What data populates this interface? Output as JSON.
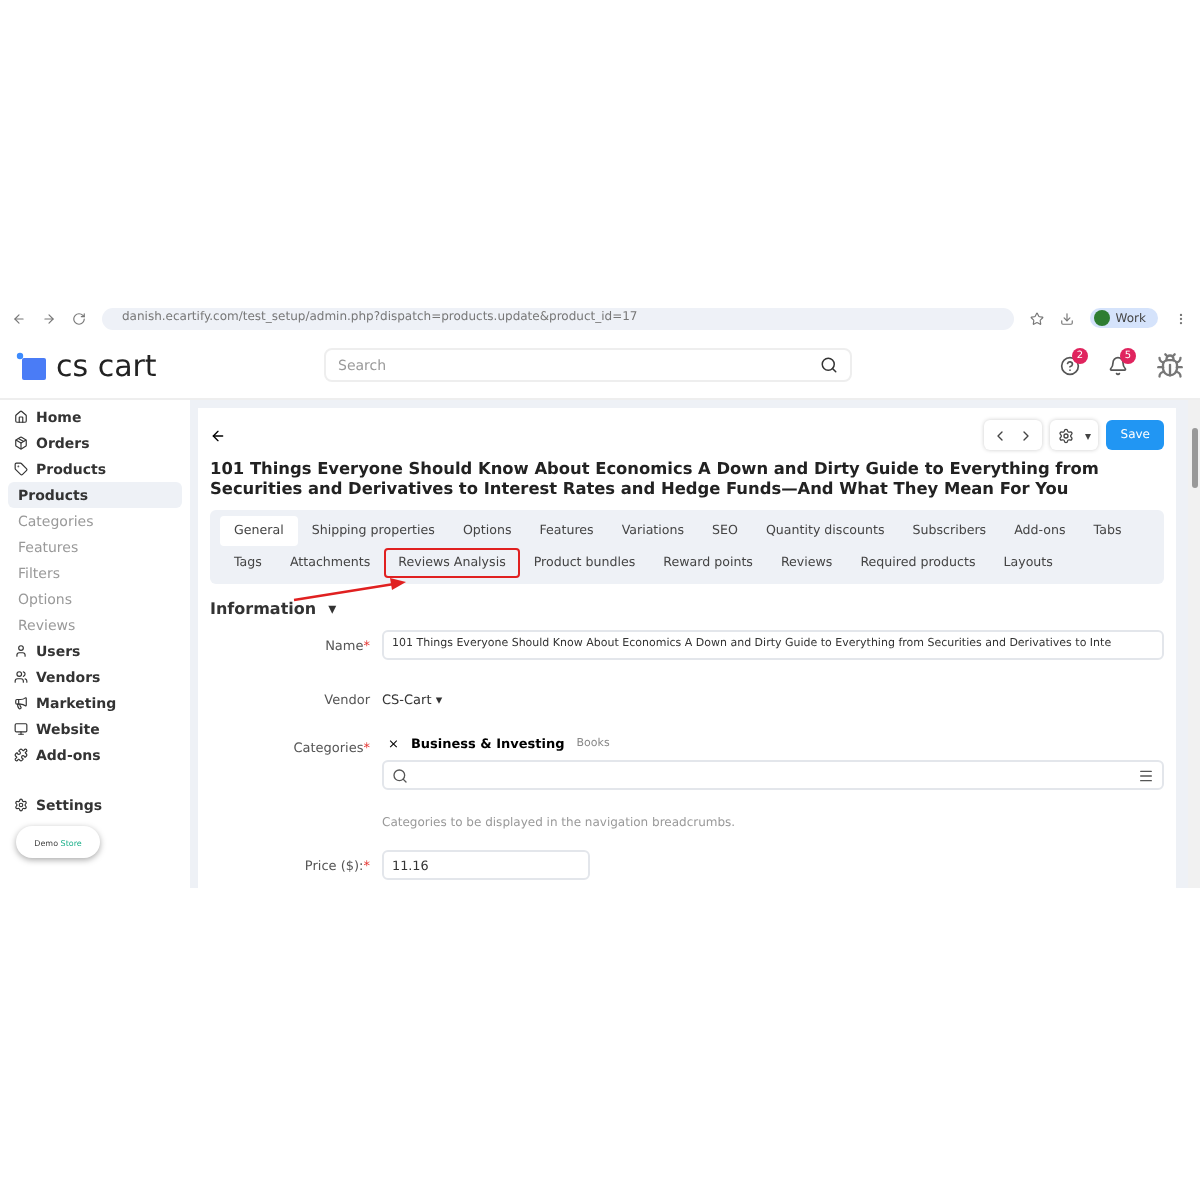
{
  "browser": {
    "url": "danish.ecartify.com/test_setup/admin.php?dispatch=products.update&product_id=17",
    "profile": "Work"
  },
  "header": {
    "logo": "cs cart",
    "search_placeholder": "Search",
    "help_badge": "2",
    "notifications_badge": "5"
  },
  "sidebar": {
    "items": [
      {
        "label": "Home",
        "kind": "main",
        "selected": false
      },
      {
        "label": "Orders",
        "kind": "main",
        "selected": false
      },
      {
        "label": "Products",
        "kind": "main",
        "selected": false
      },
      {
        "label": "Products",
        "kind": "sub",
        "selected": true
      },
      {
        "label": "Categories",
        "kind": "sub",
        "selected": false
      },
      {
        "label": "Features",
        "kind": "sub",
        "selected": false
      },
      {
        "label": "Filters",
        "kind": "sub",
        "selected": false
      },
      {
        "label": "Options",
        "kind": "sub",
        "selected": false
      },
      {
        "label": "Reviews",
        "kind": "sub",
        "selected": false
      },
      {
        "label": "Users",
        "kind": "main",
        "selected": false
      },
      {
        "label": "Vendors",
        "kind": "main",
        "selected": false
      },
      {
        "label": "Marketing",
        "kind": "main",
        "selected": false
      },
      {
        "label": "Website",
        "kind": "main",
        "selected": false
      },
      {
        "label": "Add-ons",
        "kind": "main",
        "selected": false
      }
    ],
    "settings": "Settings",
    "store_badge": {
      "first": "Demo",
      "second": "Store"
    }
  },
  "toolbar": {
    "save": "Save"
  },
  "title": "101 Things Everyone Should Know About Economics A Down and Dirty Guide to Everything from Securities and Derivatives to Interest Rates and Hedge Funds—And What They Mean For You",
  "tab_rows": [
    [
      {
        "label": "General",
        "selected": true,
        "highlighted": false
      },
      {
        "label": "Shipping properties",
        "selected": false,
        "highlighted": false
      },
      {
        "label": "Options",
        "selected": false,
        "highlighted": false
      },
      {
        "label": "Features",
        "selected": false,
        "highlighted": false
      },
      {
        "label": "Variations",
        "selected": false,
        "highlighted": false
      },
      {
        "label": "SEO",
        "selected": false,
        "highlighted": false
      },
      {
        "label": "Quantity discounts",
        "selected": false,
        "highlighted": false
      },
      {
        "label": "Subscribers",
        "selected": false,
        "highlighted": false
      },
      {
        "label": "Add-ons",
        "selected": false,
        "highlighted": false
      },
      {
        "label": "Tabs",
        "selected": false,
        "highlighted": false
      }
    ],
    [
      {
        "label": "Tags",
        "selected": false,
        "highlighted": false
      },
      {
        "label": "Attachments",
        "selected": false,
        "highlighted": false
      },
      {
        "label": "Reviews Analysis",
        "selected": false,
        "highlighted": true
      },
      {
        "label": "Product bundles",
        "selected": false,
        "highlighted": false
      },
      {
        "label": "Reward points",
        "selected": false,
        "highlighted": false
      },
      {
        "label": "Reviews",
        "selected": false,
        "highlighted": false
      },
      {
        "label": "Required products",
        "selected": false,
        "highlighted": false
      },
      {
        "label": "Layouts",
        "selected": false,
        "highlighted": false
      }
    ]
  ],
  "section": {
    "title": "Information",
    "caret": "▾"
  },
  "settings_caret": "▾",
  "form": {
    "name": {
      "label": "Name",
      "required": "*",
      "value": "101 Things Everyone Should Know About Economics A Down and Dirty Guide to Everything from Securities and Derivatives to Inte"
    },
    "vendor": {
      "label": "Vendor",
      "value": "CS-Cart",
      "caret": "▾"
    },
    "categories": {
      "label": "Categories",
      "required": "*",
      "remove": "×",
      "category": "Business & Investing",
      "parent": "Books",
      "hint": "Categories to be displayed in the navigation breadcrumbs."
    },
    "price": {
      "label": "Price ($):",
      "required": "*",
      "value": "11.16"
    }
  }
}
